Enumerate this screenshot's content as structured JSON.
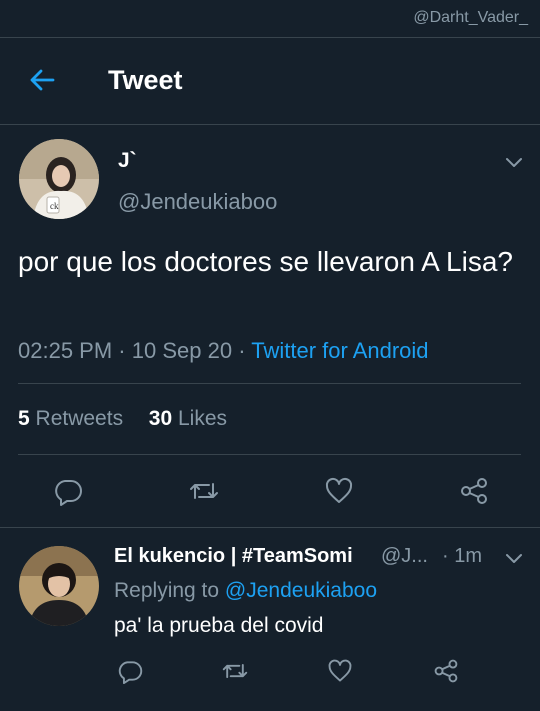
{
  "watermark": "@Darht_Vader_",
  "header": {
    "title": "Tweet"
  },
  "tweet": {
    "author_name": "J`",
    "author_handle": "@Jendeukiaboo",
    "text": "por que los doctores se llevaron A Lisa?",
    "time": "02:25 PM",
    "date": "10 Sep 20",
    "separator": "·",
    "source": "Twitter for Android",
    "retweet_count": "5",
    "retweet_label": "Retweets",
    "like_count": "30",
    "like_label": "Likes"
  },
  "reply": {
    "author_name": "El kukencio | #TeamSomi",
    "author_handle": "@J...",
    "time": "· 1m",
    "replying_prefix": "Replying to",
    "replying_to": "@Jendeukiaboo",
    "text": "pa' la prueba del covid"
  },
  "icons": {
    "back": "back-arrow-icon",
    "menu": "chevron-down-icon",
    "reply": "reply-icon",
    "retweet": "retweet-icon",
    "like": "heart-icon",
    "share": "share-icon"
  },
  "colors": {
    "background": "#15202b",
    "accent": "#1da1f2",
    "muted": "#8899a6",
    "divider": "#38444d"
  }
}
